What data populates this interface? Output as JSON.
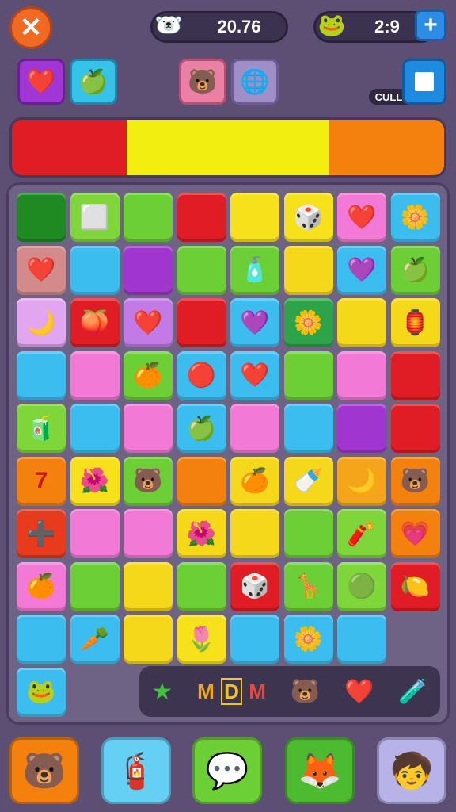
{
  "hud": {
    "close_icon": "✕",
    "score_avatar": "🐻‍❄️",
    "score_value": "20.76",
    "moves_avatar": "🐸",
    "moves_value": "2:9",
    "plus_label": "+"
  },
  "boosters": [
    {
      "icon": "❤️",
      "bg": "#a136d6",
      "border": "#6c1e96"
    },
    {
      "icon": "🍏",
      "bg": "#35c3ea",
      "border": "#1a88b0"
    },
    {
      "icon": "🐻",
      "bg": "#ec7fa4",
      "border": "#b84e76"
    },
    {
      "icon": "🌐",
      "bg": "#9f8fc6",
      "border": "#6b5c96"
    }
  ],
  "cull_label": "CULL",
  "progress_segments": [
    {
      "color": "#e01c24",
      "fraction": 0.265
    },
    {
      "color": "#f2ee10",
      "fraction": 0.47
    },
    {
      "color": "#f4800e",
      "fraction": 0.265
    }
  ],
  "board": {
    "rows": [
      [
        {
          "c": "#1f8a22",
          "i": ""
        },
        {
          "c": "#7ed63a",
          "i": "⬜"
        },
        {
          "c": "#6ccf35",
          "i": ""
        },
        {
          "c": "#e01c24",
          "i": ""
        },
        {
          "c": "#f6e11a",
          "i": ""
        },
        {
          "c": "#f6e11a",
          "i": "🎲"
        },
        {
          "c": "#f27ad6",
          "i": "❤️"
        },
        {
          "c": "#3cbdf0",
          "i": "🌼"
        }
      ],
      [
        {
          "c": "#d38a8a",
          "i": "❤️"
        },
        {
          "c": "#3cbdf0",
          "i": ""
        },
        {
          "c": "#a135d0",
          "i": ""
        },
        {
          "c": "#6ccf35",
          "i": ""
        },
        {
          "c": "#6ccf35",
          "i": "🧴"
        },
        {
          "c": "#f6d81a",
          "i": ""
        },
        {
          "c": "#3cbdf0",
          "i": "💜"
        },
        {
          "c": "#6ccf35",
          "i": "🍏"
        }
      ],
      [
        {
          "c": "#e2a6f0",
          "i": "🌙"
        },
        {
          "c": "#e01c24",
          "i": "🍑"
        },
        {
          "c": "#c27ae6",
          "i": "❤️"
        },
        {
          "c": "#e01c24",
          "i": ""
        },
        {
          "c": "#3cbdf0",
          "i": "💜"
        },
        {
          "c": "#2da44a",
          "i": "🌼"
        },
        {
          "c": "#f6d81a",
          "i": ""
        },
        {
          "c": "#f6d81a",
          "i": "🏮"
        }
      ],
      [
        {
          "c": "#3cbdf0",
          "i": ""
        },
        {
          "c": "#f27ad6",
          "i": ""
        },
        {
          "c": "#6ccf35",
          "i": "🍊"
        },
        {
          "c": "#3cbdf0",
          "i": "🔴"
        },
        {
          "c": "#3cbdf0",
          "i": "❤️"
        },
        {
          "c": "#6ccf35",
          "i": ""
        },
        {
          "c": "#f27ad6",
          "i": ""
        },
        {
          "c": "#e01c24",
          "i": ""
        }
      ],
      [
        {
          "c": "#7ed63a",
          "i": "🧃"
        },
        {
          "c": "#3cbdf0",
          "i": ""
        },
        {
          "c": "#f27ad6",
          "i": ""
        },
        {
          "c": "#3cbdf0",
          "i": "🍏"
        },
        {
          "c": "#f27ad6",
          "i": ""
        },
        {
          "c": "#3cbdf0",
          "i": ""
        },
        {
          "c": "#a135d0",
          "i": ""
        },
        {
          "c": "#e01c24",
          "i": ""
        }
      ],
      [
        {
          "c": "#f4800e",
          "i": "7"
        },
        {
          "c": "#f6e11a",
          "i": "🌺"
        },
        {
          "c": "#6ccf35",
          "i": "🐻"
        },
        {
          "c": "#f4800e",
          "i": ""
        },
        {
          "c": "#f6d81a",
          "i": "🍊"
        },
        {
          "c": "#f6d81a",
          "i": "🍼"
        },
        {
          "c": "#f4a51a",
          "i": "🌙"
        },
        {
          "c": "#f4800e",
          "i": "🐻"
        }
      ],
      [
        {
          "c": "#e83a1c",
          "i": "➕"
        },
        {
          "c": "#f27ad6",
          "i": ""
        },
        {
          "c": "#f27ad6",
          "i": ""
        },
        {
          "c": "#f6d81a",
          "i": "🌺"
        },
        {
          "c": "#f6d81a",
          "i": ""
        },
        {
          "c": "#6ccf35",
          "i": ""
        },
        {
          "c": "#7ed63a",
          "i": "🧨"
        },
        {
          "c": "#f4800e",
          "i": "💗"
        }
      ],
      [
        {
          "c": "#f27ad6",
          "i": "🍊"
        },
        {
          "c": "#6ccf35",
          "i": ""
        },
        {
          "c": "#f6d81a",
          "i": ""
        },
        {
          "c": "#6ccf35",
          "i": ""
        },
        {
          "c": "#e01c24",
          "i": "🎲"
        },
        {
          "c": "#6ccf35",
          "i": "🦒"
        },
        {
          "c": "#7ed63a",
          "i": "🟢"
        },
        {
          "c": "#e01c24",
          "i": "🍋"
        }
      ],
      [
        {
          "c": "#3cbdf0",
          "i": ""
        },
        {
          "c": "#3cbdf0",
          "i": "🥕"
        },
        {
          "c": "#f6d81a",
          "i": ""
        },
        {
          "c": "#f6e11a",
          "i": "🌷"
        },
        {
          "c": "#3cbdf0",
          "i": ""
        },
        {
          "c": "#3cbdf0",
          "i": "🌼"
        },
        {
          "c": "#3cbdf0",
          "i": ""
        },
        null
      ],
      [
        {
          "c": "#3cbdf0",
          "i": "🐸"
        },
        null,
        null,
        null,
        null,
        null,
        null,
        null
      ]
    ]
  },
  "collect_tray": {
    "star": "★",
    "letters": [
      "M",
      "D",
      "M"
    ],
    "bear": "🐻",
    "heart": "❤️",
    "brush": "🧪"
  },
  "powerups": [
    {
      "icon": "🐻",
      "bg": "#f4800e"
    },
    {
      "icon": "🧯",
      "bg": "#66d0f4"
    },
    {
      "icon": "💬",
      "bg": "#6ccf35"
    },
    {
      "icon": "🦊",
      "bg": "#4cbb30"
    },
    {
      "icon": "🧒",
      "bg": "#b7b3e8"
    }
  ]
}
